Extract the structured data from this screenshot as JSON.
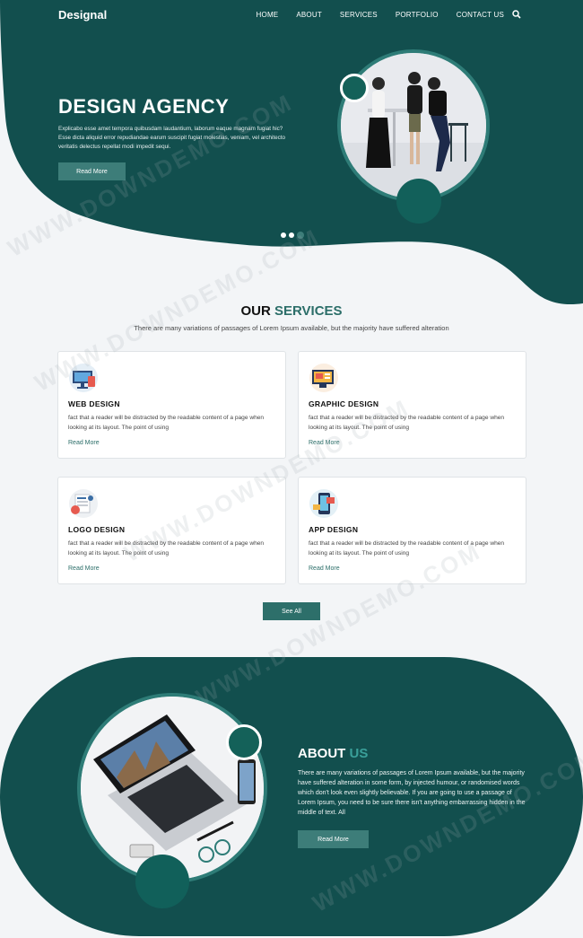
{
  "nav": {
    "logo": "Designal",
    "items": [
      "HOME",
      "ABOUT",
      "SERVICES",
      "PORTFOLIO",
      "CONTACT US"
    ],
    "search_icon": "search-icon"
  },
  "hero": {
    "title": "DESIGN AGENCY",
    "text": "Explicabo esse amet tempora quibusdam laudantium, laborum eaque magnam fugiat hic? Esse dicta aliquid error repudiandae earum suscipit fugiat molestias, veniam, vel architecto veritatis delectus repellat modi impedit sequi.",
    "button": "Read More",
    "slider_count": 3,
    "slider_active": 3
  },
  "services": {
    "title_main": "OUR ",
    "title_accent": "SERVICES",
    "subtitle": "There are many variations of passages of Lorem Ipsum available, but the majority have suffered alteration",
    "cards": [
      {
        "title": "WEB DESIGN",
        "text": "fact that a reader will be distracted by the readable content of a page when looking at its layout. The point of using",
        "link": "Read More",
        "icon": "web-design-icon"
      },
      {
        "title": "GRAPHIC DESIGN",
        "text": "fact that a reader will be distracted by the readable content of a page when looking at its layout. The point of using",
        "link": "Read More",
        "icon": "graphic-design-icon"
      },
      {
        "title": "LOGO DESIGN",
        "text": "fact that a reader will be distracted by the readable content of a page when looking at its layout. The point of using",
        "link": "Read More",
        "icon": "logo-design-icon"
      },
      {
        "title": "APP DESIGN",
        "text": "fact that a reader will be distracted by the readable content of a page when looking at its layout. The point of using",
        "link": "Read More",
        "icon": "app-design-icon"
      }
    ],
    "see_all": "See All"
  },
  "about": {
    "title_main": "ABOUT ",
    "title_accent": "US",
    "text": "There are many variations of passages of Lorem Ipsum available, but the majority have suffered alteration in some form, by injected humour, or randomised words which don't look even slightly believable. If you are going to use a passage of Lorem Ipsum, you need to be sure there isn't anything embarrassing hidden in the middle of text. All",
    "button": "Read More"
  },
  "watermark": "WWW.DOWNDEMO.COM",
  "colors": {
    "primary": "#124f4e",
    "accent": "#2c6e69",
    "button": "#3d7d79",
    "background": "#f3f5f7"
  }
}
